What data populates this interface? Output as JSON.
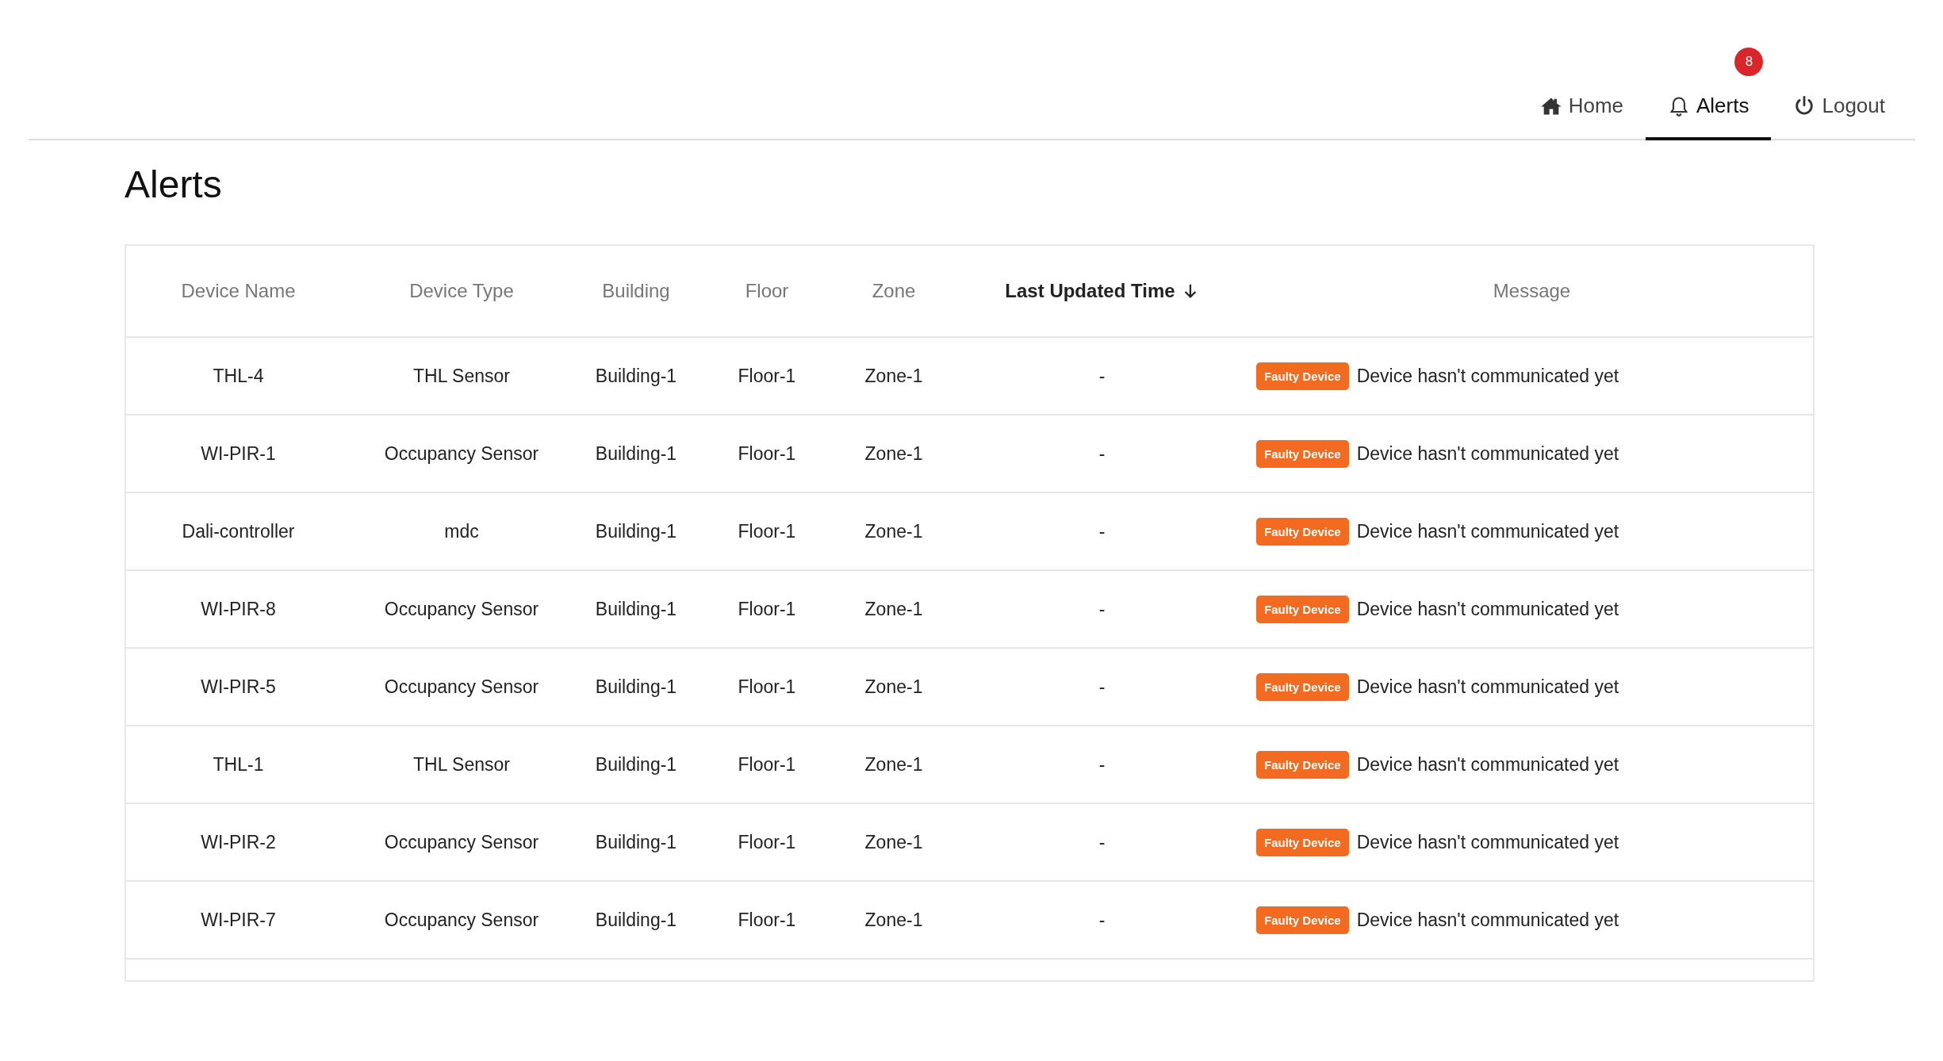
{
  "nav": [
    {
      "kind": "home",
      "label": "Home",
      "selected": false
    },
    {
      "kind": "bell",
      "label": "Alerts",
      "selected": true,
      "badge": "8"
    },
    {
      "kind": "power",
      "label": "Logout",
      "selected": false
    }
  ],
  "page_title": "Alerts",
  "table": {
    "columns": [
      {
        "label": "Device Name",
        "sorted": false
      },
      {
        "label": "Device Type",
        "sorted": false
      },
      {
        "label": "Building",
        "sorted": false
      },
      {
        "label": "Floor",
        "sorted": false
      },
      {
        "label": "Zone",
        "sorted": false
      },
      {
        "label": "Last Updated Time",
        "sorted": true
      },
      {
        "label": "Message",
        "sorted": false
      }
    ],
    "rows": [
      {
        "cells": [
          "THL-4",
          "THL Sensor",
          "Building-1",
          "Floor-1",
          "Zone-1",
          "-"
        ],
        "tag": "Faulty Device",
        "message": "Device hasn't communicated yet"
      },
      {
        "cells": [
          "WI-PIR-1",
          "Occupancy Sensor",
          "Building-1",
          "Floor-1",
          "Zone-1",
          "-"
        ],
        "tag": "Faulty Device",
        "message": "Device hasn't communicated yet"
      },
      {
        "cells": [
          "Dali-controller",
          "mdc",
          "Building-1",
          "Floor-1",
          "Zone-1",
          "-"
        ],
        "tag": "Faulty Device",
        "message": "Device hasn't communicated yet"
      },
      {
        "cells": [
          "WI-PIR-8",
          "Occupancy Sensor",
          "Building-1",
          "Floor-1",
          "Zone-1",
          "-"
        ],
        "tag": "Faulty Device",
        "message": "Device hasn't communicated yet"
      },
      {
        "cells": [
          "WI-PIR-5",
          "Occupancy Sensor",
          "Building-1",
          "Floor-1",
          "Zone-1",
          "-"
        ],
        "tag": "Faulty Device",
        "message": "Device hasn't communicated yet"
      },
      {
        "cells": [
          "THL-1",
          "THL Sensor",
          "Building-1",
          "Floor-1",
          "Zone-1",
          "-"
        ],
        "tag": "Faulty Device",
        "message": "Device hasn't communicated yet"
      },
      {
        "cells": [
          "WI-PIR-2",
          "Occupancy Sensor",
          "Building-1",
          "Floor-1",
          "Zone-1",
          "-"
        ],
        "tag": "Faulty Device",
        "message": "Device hasn't communicated yet"
      },
      {
        "cells": [
          "WI-PIR-7",
          "Occupancy Sensor",
          "Building-1",
          "Floor-1",
          "Zone-1",
          "-"
        ],
        "tag": "Faulty Device",
        "message": "Device hasn't communicated yet"
      }
    ]
  }
}
